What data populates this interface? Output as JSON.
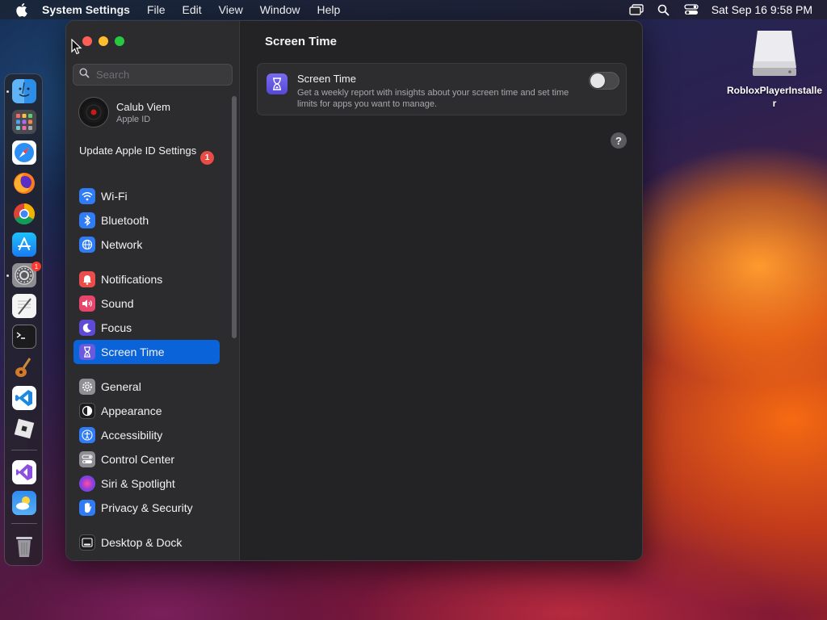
{
  "menubar": {
    "app_name": "System Settings",
    "menus": [
      "File",
      "Edit",
      "View",
      "Window",
      "Help"
    ],
    "clock": "Sat Sep 16  9:58 PM",
    "icons": [
      "apple-icon",
      "screen-mirroring-icon",
      "spotlight-search-icon",
      "control-center-icon"
    ]
  },
  "dock": {
    "apps": [
      "Finder",
      "Launchpad",
      "Safari",
      "Firefox",
      "Chrome",
      "App Store",
      "System Settings",
      "TextEdit",
      "Terminal",
      "GarageBand",
      "Visual Studio Code",
      "Roblox",
      "Visual Studio",
      "Weather",
      "Trash"
    ],
    "system_settings_badge": "1"
  },
  "desktop": {
    "file_label": "RobloxPlayerInstaller"
  },
  "sidebar": {
    "search_placeholder": "Search",
    "account": {
      "name": "Calub Viem",
      "subtitle": "Apple ID"
    },
    "update": {
      "label": "Update Apple ID Settings",
      "badge": "1"
    },
    "items": [
      {
        "label": "Wi-Fi",
        "icon": "wifi-icon",
        "color": "#2f7cf6"
      },
      {
        "label": "Bluetooth",
        "icon": "bluetooth-icon",
        "color": "#2f7cf6"
      },
      {
        "label": "Network",
        "icon": "globe-icon",
        "color": "#2f7cf6"
      },
      {
        "label": "Notifications",
        "icon": "bell-icon",
        "color": "#eb4d4b"
      },
      {
        "label": "Sound",
        "icon": "speaker-icon",
        "color": "#e8456b"
      },
      {
        "label": "Focus",
        "icon": "moon-icon",
        "color": "#5b4bd6"
      },
      {
        "label": "Screen Time",
        "icon": "hourglass-icon",
        "color": "#6a5ae0"
      },
      {
        "label": "General",
        "icon": "gear-icon",
        "color": "#8e8e93"
      },
      {
        "label": "Appearance",
        "icon": "appearance-icon",
        "color": "#1c1c1e"
      },
      {
        "label": "Accessibility",
        "icon": "accessibility-icon",
        "color": "#2f7cf6"
      },
      {
        "label": "Control Center",
        "icon": "control-center-icon",
        "color": "#8e8e93"
      },
      {
        "label": "Siri & Spotlight",
        "icon": "siri-icon",
        "color": "#b540d8"
      },
      {
        "label": "Privacy & Security",
        "icon": "hand-icon",
        "color": "#2f7cf6"
      },
      {
        "label": "Desktop & Dock",
        "icon": "dock-icon",
        "color": "#1c1c1e"
      }
    ],
    "selected": "Screen Time"
  },
  "content": {
    "title": "Screen Time",
    "card": {
      "title": "Screen Time",
      "description": "Get a weekly report with insights about your screen time and set time limits for apps you want to manage.",
      "toggle_on": false
    },
    "help_label": "?"
  },
  "colors": {
    "accent": "#0a63d9",
    "badge": "#e94b45"
  }
}
